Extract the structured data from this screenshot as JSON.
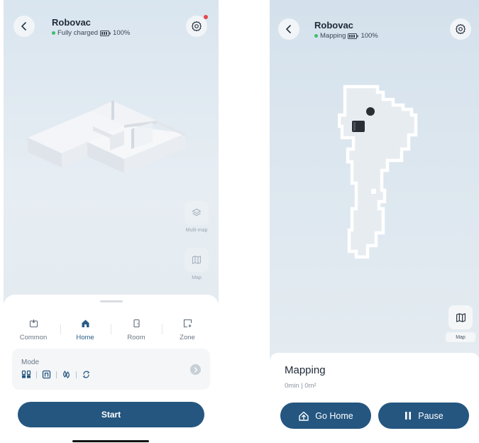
{
  "left": {
    "device_name": "Robovac",
    "status_text": "Fully charged",
    "battery_level": "100%",
    "side": {
      "multimap_label": "Multi-map",
      "map_label": "Map"
    },
    "tabs": [
      {
        "label": "Common",
        "icon": "common-icon",
        "active": false
      },
      {
        "label": "Home",
        "icon": "home-icon",
        "active": true
      },
      {
        "label": "Room",
        "icon": "room-icon",
        "active": false
      },
      {
        "label": "Zone",
        "icon": "zone-icon",
        "active": false
      }
    ],
    "mode_label": "Mode",
    "mode_icons": [
      "vacuum-mop-icon",
      "vacuum-icon",
      "mop-icon",
      "vacuum-then-mop-icon"
    ],
    "start_label": "Start"
  },
  "right": {
    "device_name": "Robovac",
    "status_text": "Mapping",
    "battery_level": "100%",
    "map_label": "Map",
    "sheet_title": "Mapping",
    "sheet_sub": "0min | 0m²",
    "go_home_label": "Go Home",
    "pause_label": "Pause"
  },
  "colors": {
    "primary": "#245680",
    "status_dot": "#3dbf6a",
    "notification_dot": "#e5484d"
  }
}
